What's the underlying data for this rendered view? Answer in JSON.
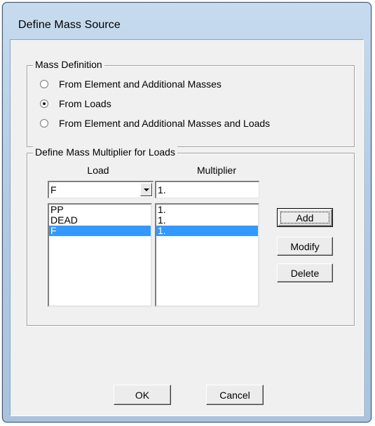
{
  "window": {
    "title": "Define Mass Source"
  },
  "mass_definition": {
    "legend": "Mass Definition",
    "options": [
      {
        "label": "From Element and Additional Masses",
        "checked": false
      },
      {
        "label": "From Loads",
        "checked": true
      },
      {
        "label": "From Element and Additional Masses and Loads",
        "checked": false
      }
    ]
  },
  "multiplier_group": {
    "legend": "Define Mass Multiplier for Loads",
    "load_header": "Load",
    "multiplier_header": "Multiplier",
    "load_select_value": "F",
    "multiplier_input_value": "1.",
    "load_list": [
      "PP",
      "DEAD",
      "F"
    ],
    "multiplier_list": [
      "1.",
      "1.",
      "1."
    ],
    "selected_index": 2,
    "buttons": {
      "add": "Add",
      "modify": "Modify",
      "delete": "Delete"
    }
  },
  "footer": {
    "ok": "OK",
    "cancel": "Cancel"
  },
  "colors": {
    "selection": "#3399ff",
    "title_gradient_top": "#c7dbee",
    "dialog_bg": "#f0f0f0"
  }
}
